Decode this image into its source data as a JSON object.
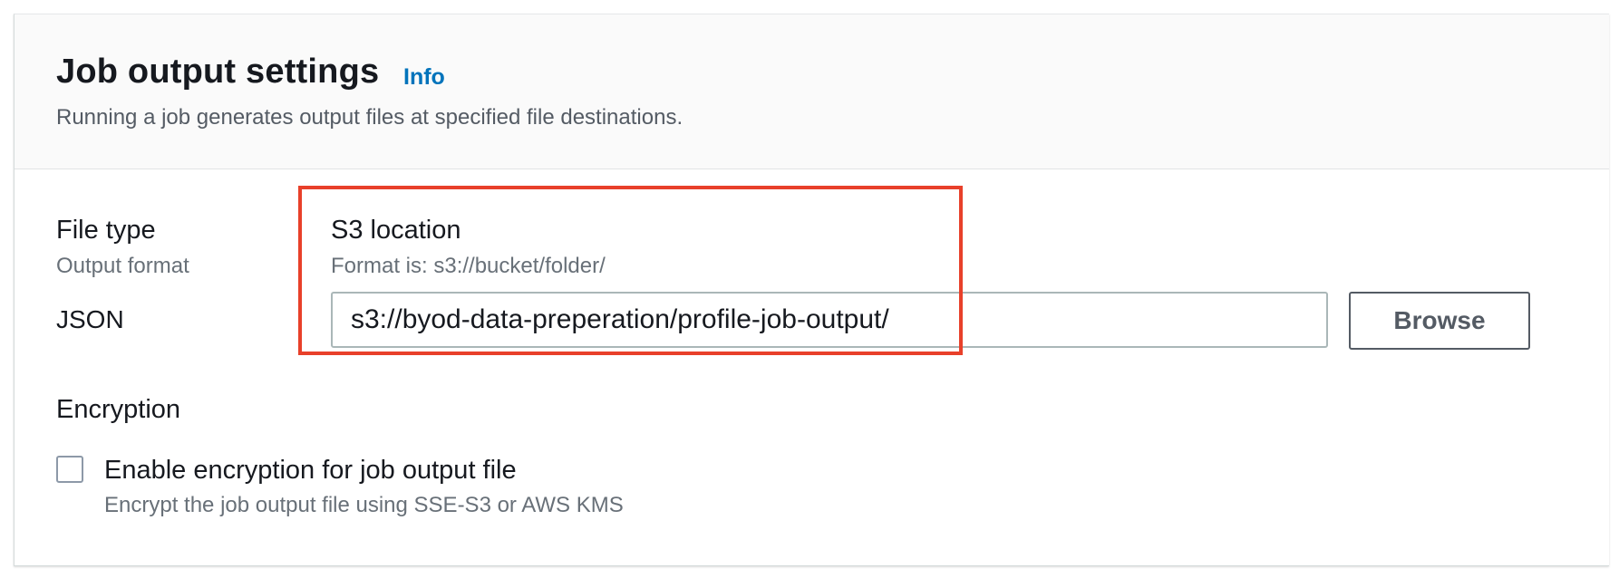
{
  "header": {
    "title": "Job output settings",
    "info_link": "Info",
    "description": "Running a job generates output files at specified file destinations."
  },
  "file_type": {
    "label": "File type",
    "sublabel": "Output format",
    "value": "JSON"
  },
  "s3_location": {
    "label": "S3 location",
    "sublabel": "Format is: s3://bucket/folder/",
    "value": "s3://byod-data-preperation/profile-job-output/",
    "browse_label": "Browse"
  },
  "encryption": {
    "label": "Encryption",
    "checkbox_label": "Enable encryption for job output file",
    "checkbox_description": "Encrypt the job output file using SSE-S3 or AWS KMS",
    "checked": false
  },
  "colors": {
    "link": "#0073bb",
    "highlight": "#e8402a",
    "text": "#16191f",
    "muted": "#687078"
  }
}
